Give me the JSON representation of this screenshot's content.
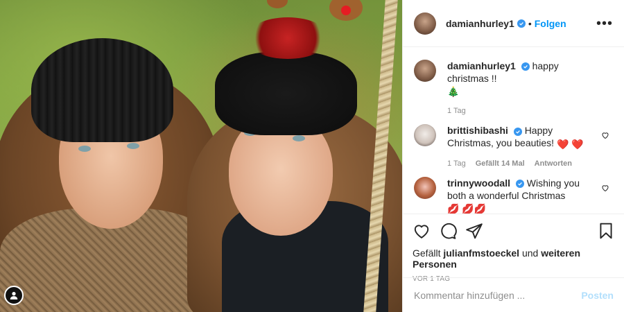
{
  "post": {
    "username": "damianhurley1",
    "follow_label": "Folgen",
    "separator": "•",
    "more_label": "•••"
  },
  "caption": {
    "username": "damianhurley1",
    "text": "happy christmas !!",
    "emoji": "🎄",
    "time": "1 Tag"
  },
  "comments": [
    {
      "username": "brittishibashi",
      "text": "Happy Christmas, you beauties!",
      "emoji": "❤️ ❤️",
      "time": "1 Tag",
      "likes": "Gefällt 14 Mal",
      "reply": "Antworten"
    },
    {
      "username": "trinnywoodall",
      "text": "Wishing you both a wonderful Christmas",
      "emoji": "💋 💋💋"
    }
  ],
  "likes": {
    "prefix": "Gefällt",
    "user": "julianfmstoeckel",
    "middle": "und",
    "others": "weiteren Personen"
  },
  "date_label": "VOR 1 TAG",
  "add_comment": {
    "placeholder": "Kommentar hinzufügen ...",
    "post_label": "Posten"
  },
  "colors": {
    "accent": "#0095f6",
    "verified": "#3897f0",
    "post_disabled": "#b2dffc",
    "muted": "#8e8e8e"
  }
}
